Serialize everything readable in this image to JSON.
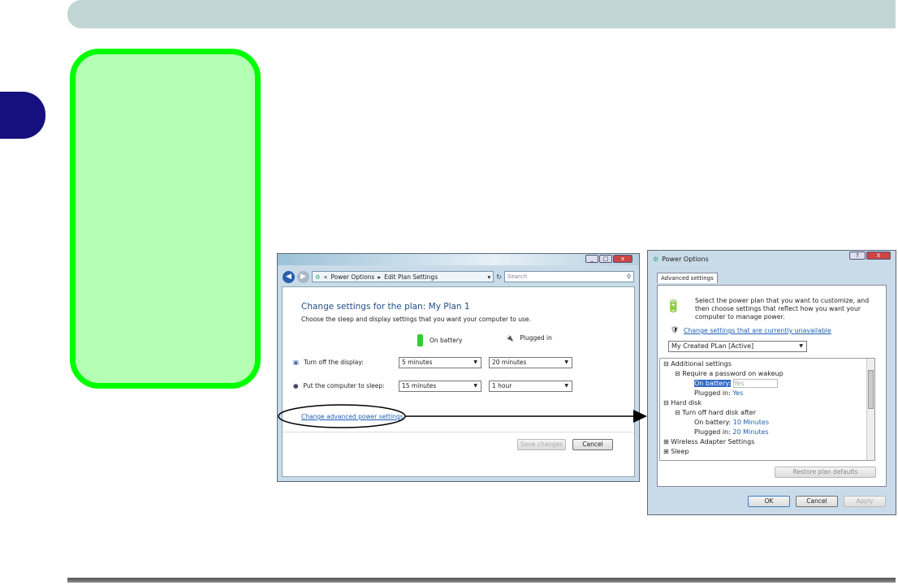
{
  "colors": {
    "header_bar": "#c1d6d4",
    "chapter_tab": "#16107f",
    "note_border": "#00ff00",
    "note_fill": "#b5ffb5",
    "link": "#1c5fb5"
  },
  "edit_plan_window": {
    "breadcrumb": [
      "Power Options",
      "Edit Plan Settings"
    ],
    "search_placeholder": "Search",
    "heading": "Change settings for the plan: My Plan 1",
    "subheading": "Choose the sleep and display settings that you want your computer to use.",
    "col_battery": "On battery",
    "col_plugged": "Plugged in",
    "rows": [
      {
        "label": "Turn off the display:",
        "battery": "5 minutes",
        "plugged": "20 minutes",
        "icon": "display-icon"
      },
      {
        "label": "Put the computer to sleep:",
        "battery": "15 minutes",
        "plugged": "1 hour",
        "icon": "sleep-icon"
      }
    ],
    "advanced_link": "Change advanced power settings",
    "save_button": "Save changes",
    "cancel_button": "Cancel"
  },
  "power_options_dialog": {
    "title": "Power Options",
    "help": "?",
    "close": "X",
    "tab": "Advanced settings",
    "intro": "Select the power plan that you want to customize, and then choose settings that reflect how you want your computer to manage power.",
    "unavailable_link": "Change settings that are currently unavailable",
    "plan_select": "My Created PLan [Active]",
    "tree": {
      "additional": "Additional settings",
      "password": "Require a password on wakeup",
      "on_battery": "On battery:",
      "pw_battery": "Yes",
      "plugged_in": "Plugged in:",
      "pw_plugged": "Yes",
      "hard_disk": "Hard disk",
      "turn_off_disk": "Turn off hard disk after",
      "disk_battery": "10 Minutes",
      "disk_plugged": "20 Minutes",
      "wireless": "Wireless Adapter Settings",
      "sleep": "Sleep"
    },
    "restore_button": "Restore plan defaults",
    "ok_button": "OK",
    "cancel_button": "Cancel",
    "apply_button": "Apply"
  }
}
